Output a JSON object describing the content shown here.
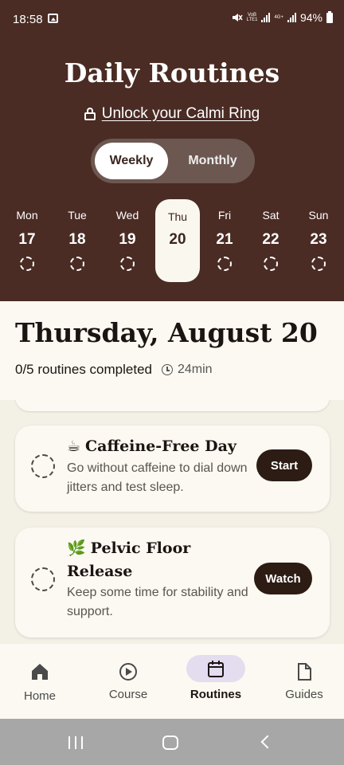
{
  "status_bar": {
    "time": "18:58",
    "battery": "94%",
    "network_top": "VoB",
    "network_bottom": "LTE1",
    "network2": "4G+"
  },
  "header": {
    "title": "Daily Routines",
    "unlock_label": "Unlock your Calmi Ring"
  },
  "view_toggle": {
    "weekly": "Weekly",
    "monthly": "Monthly",
    "selected": "Weekly"
  },
  "week": [
    {
      "name": "Mon",
      "date": "17"
    },
    {
      "name": "Tue",
      "date": "18"
    },
    {
      "name": "Wed",
      "date": "19"
    },
    {
      "name": "Thu",
      "date": "20",
      "selected": true
    },
    {
      "name": "Fri",
      "date": "21"
    },
    {
      "name": "Sat",
      "date": "22"
    },
    {
      "name": "Sun",
      "date": "23"
    }
  ],
  "day_summary": {
    "date_title": "Thursday, August 20",
    "completed": "0/5 routines completed",
    "duration": "24min"
  },
  "routines": [
    {
      "emoji": "☕",
      "title": "Caffeine-Free Day",
      "description": "Go without caffeine to dial down jitters and test sleep.",
      "action": "Start"
    },
    {
      "emoji": "🌿",
      "title_line1": "Pelvic Floor",
      "title_line2": "Release",
      "description": "Keep some time for stability and support.",
      "action": "Watch"
    }
  ],
  "nav": {
    "home": "Home",
    "course": "Course",
    "routines": "Routines",
    "guides": "Guides",
    "active": "Routines"
  },
  "colors": {
    "header_bg": "#4a2c24",
    "sheet_bg": "#faf7ee",
    "button_bg": "#2d1c14",
    "nav_active_pill": "#e4ddf0"
  }
}
